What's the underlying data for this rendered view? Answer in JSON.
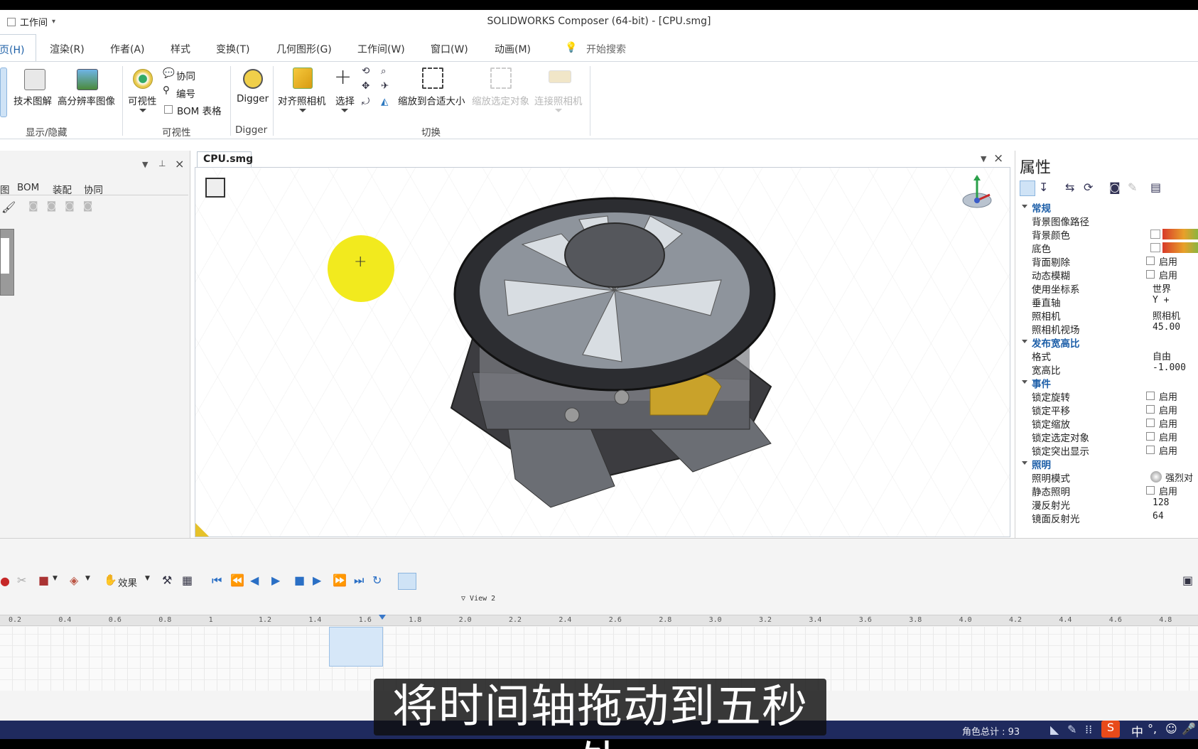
{
  "window": {
    "title": "SOLIDWORKS Composer (64-bit) - [CPU.smg]",
    "quick_access_label": "工作间"
  },
  "menu": [
    "页(H)",
    "渲染(R)",
    "作者(A)",
    "样式",
    "变换(T)",
    "几何图形(G)",
    "工作间(W)",
    "窗口(W)",
    "动画(M)"
  ],
  "search_placeholder": "开始搜索",
  "ribbon": {
    "tech_illustration": "技术图解",
    "hi_res_image": "高分辨率图像",
    "group_show_hide": "显示/隐藏",
    "visibility": "可视性",
    "collab": "协同",
    "numbering": "编号",
    "bom_table": "BOM 表格",
    "group_visibility": "可视性",
    "digger": "Digger",
    "group_digger": "Digger",
    "align_camera": "对齐照相机",
    "select": "选择",
    "zoom_fit": "缩放到合适大小",
    "zoom_selected": "缩放选定对象",
    "link_camera": "连接照相机",
    "group_switch": "切换"
  },
  "left_panel": {
    "tabs": [
      "图",
      "BOM",
      "装配",
      "协同"
    ]
  },
  "document_tab": "CPU.smg",
  "properties": {
    "title": "属性",
    "rows": [
      {
        "type": "section",
        "label": "常规"
      },
      {
        "label": "背景图像路径",
        "value": ""
      },
      {
        "label": "背景颜色",
        "value": ""
      },
      {
        "label": "底色",
        "value": ""
      },
      {
        "label": "背面剔除",
        "value": "启用",
        "checkbox": true
      },
      {
        "label": "动态模糊",
        "value": "启用",
        "checkbox": true
      },
      {
        "label": "使用坐标系",
        "value": "世界"
      },
      {
        "label": "垂直轴",
        "value": "Y +"
      },
      {
        "label": "照相机",
        "value": "照相机"
      },
      {
        "label": "照相机视场",
        "value": "45.00"
      },
      {
        "type": "section",
        "label": "发布宽高比"
      },
      {
        "label": "格式",
        "value": "自由"
      },
      {
        "label": "宽高比",
        "value": "-1.000"
      },
      {
        "type": "section",
        "label": "事件"
      },
      {
        "label": "锁定旋转",
        "value": "启用",
        "checkbox": true
      },
      {
        "label": "锁定平移",
        "value": "启用",
        "checkbox": true
      },
      {
        "label": "锁定缩放",
        "value": "启用",
        "checkbox": true
      },
      {
        "label": "锁定选定对象",
        "value": "启用",
        "checkbox": true
      },
      {
        "label": "锁定突出显示",
        "value": "启用",
        "checkbox": true
      },
      {
        "type": "section",
        "label": "照明"
      },
      {
        "label": "照明模式",
        "value": "强烈对"
      },
      {
        "label": "静态照明",
        "value": "启用",
        "checkbox": true
      },
      {
        "label": "漫反射光",
        "value": "128"
      },
      {
        "label": "镜面反射光",
        "value": "64"
      }
    ]
  },
  "timeline": {
    "effects_label": "效果",
    "view_marker": "View 2",
    "ticks": [
      "0.2",
      "0.4",
      "0.6",
      "0.8",
      "1",
      "1.2",
      "1.4",
      "1.6",
      "1.8",
      "2.0",
      "2.2",
      "2.4",
      "2.6",
      "2.8",
      "3.0",
      "3.2",
      "3.4",
      "3.6",
      "3.8",
      "4.0",
      "4.2",
      "4.4",
      "4.6",
      "4.8"
    ]
  },
  "status": {
    "actor_count": "角色总计 : 93",
    "ime": "中"
  },
  "subtitle": "将时间轴拖动到五秒处",
  "colors": {
    "accent": "#1c5ea8",
    "status_bar": "#1f2a5e",
    "highlight": "#f2ea1e"
  }
}
